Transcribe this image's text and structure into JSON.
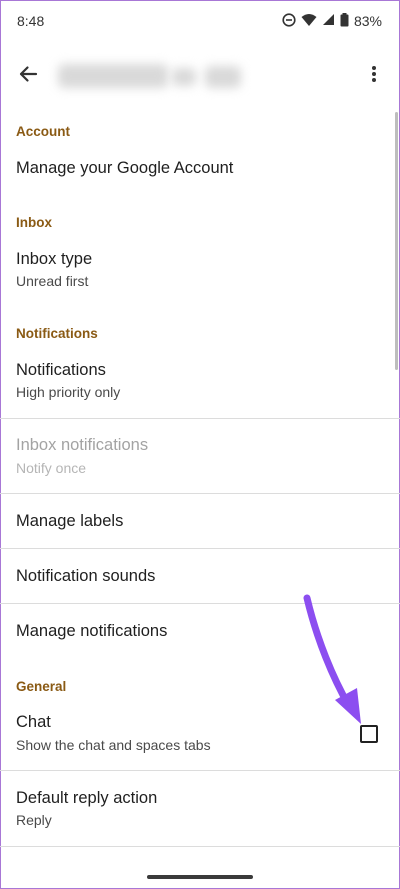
{
  "status_bar": {
    "time": "8:48",
    "battery": "83%"
  },
  "app_bar": {
    "back_icon": "arrow-back-icon",
    "menu_icon": "more-vert-icon"
  },
  "sections": {
    "account": {
      "header": "Account",
      "items": {
        "manage_account": {
          "title": "Manage your Google Account"
        }
      }
    },
    "inbox": {
      "header": "Inbox",
      "items": {
        "inbox_type": {
          "title": "Inbox type",
          "subtitle": "Unread first"
        }
      }
    },
    "notifications": {
      "header": "Notifications",
      "items": {
        "notifications": {
          "title": "Notifications",
          "subtitle": "High priority only"
        },
        "inbox_notifications": {
          "title": "Inbox notifications",
          "subtitle": "Notify once"
        },
        "manage_labels": {
          "title": "Manage labels"
        },
        "notification_sounds": {
          "title": "Notification sounds"
        },
        "manage_notifications": {
          "title": "Manage notifications"
        }
      }
    },
    "general": {
      "header": "General",
      "items": {
        "chat": {
          "title": "Chat",
          "subtitle": "Show the chat and spaces tabs",
          "checked": false
        },
        "default_reply": {
          "title": "Default reply action",
          "subtitle": "Reply"
        }
      }
    }
  },
  "colors": {
    "section_header": "#8a5a14",
    "annotation_arrow": "#8c4ef0",
    "frame_border": "#a877d6"
  }
}
